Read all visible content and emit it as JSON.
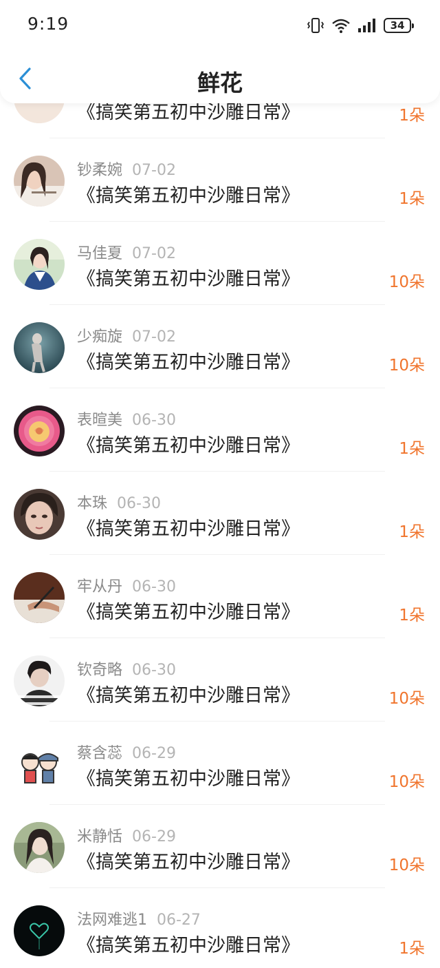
{
  "status_bar": {
    "time": "9:19",
    "battery": "34"
  },
  "nav": {
    "title": "鲜花"
  },
  "colors": {
    "accent_blue": "#2b8fd6",
    "amount_orange": "#f0742c",
    "name_gray": "#8a8a8a",
    "date_gray": "#b4b4b4"
  },
  "records": [
    {
      "name": "",
      "date": "",
      "book": "《搞笑第五初中沙雕日常》",
      "amount": "1朵",
      "avatar": "portrait-avatar"
    },
    {
      "name": "钞柔婉",
      "date": "07-02",
      "book": "《搞笑第五初中沙雕日常》",
      "amount": "1朵",
      "avatar": "portrait-avatar"
    },
    {
      "name": "马佳夏",
      "date": "07-02",
      "book": "《搞笑第五初中沙雕日常》",
      "amount": "10朵",
      "avatar": "portrait-avatar"
    },
    {
      "name": "少痴旋",
      "date": "07-02",
      "book": "《搞笑第五初中沙雕日常》",
      "amount": "10朵",
      "avatar": "portrait-avatar"
    },
    {
      "name": "表暄美",
      "date": "06-30",
      "book": "《搞笑第五初中沙雕日常》",
      "amount": "1朵",
      "avatar": "rose-avatar"
    },
    {
      "name": "本珠",
      "date": "06-30",
      "book": "《搞笑第五初中沙雕日常》",
      "amount": "1朵",
      "avatar": "portrait-avatar"
    },
    {
      "name": "牢从丹",
      "date": "06-30",
      "book": "《搞笑第五初中沙雕日常》",
      "amount": "1朵",
      "avatar": "writing-hand-avatar"
    },
    {
      "name": "钦奇略",
      "date": "06-30",
      "book": "《搞笑第五初中沙雕日常》",
      "amount": "10朵",
      "avatar": "portrait-avatar"
    },
    {
      "name": "蔡含蕊",
      "date": "06-29",
      "book": "《搞笑第五初中沙雕日常》",
      "amount": "10朵",
      "avatar": "cartoon-avatar"
    },
    {
      "name": "米静恬",
      "date": "06-29",
      "book": "《搞笑第五初中沙雕日常》",
      "amount": "10朵",
      "avatar": "portrait-avatar"
    },
    {
      "name": "法网难逃1",
      "date": "06-27",
      "book": "《搞笑第五初中沙雕日常》",
      "amount": "1朵",
      "avatar": "dark-heart-avatar"
    }
  ]
}
